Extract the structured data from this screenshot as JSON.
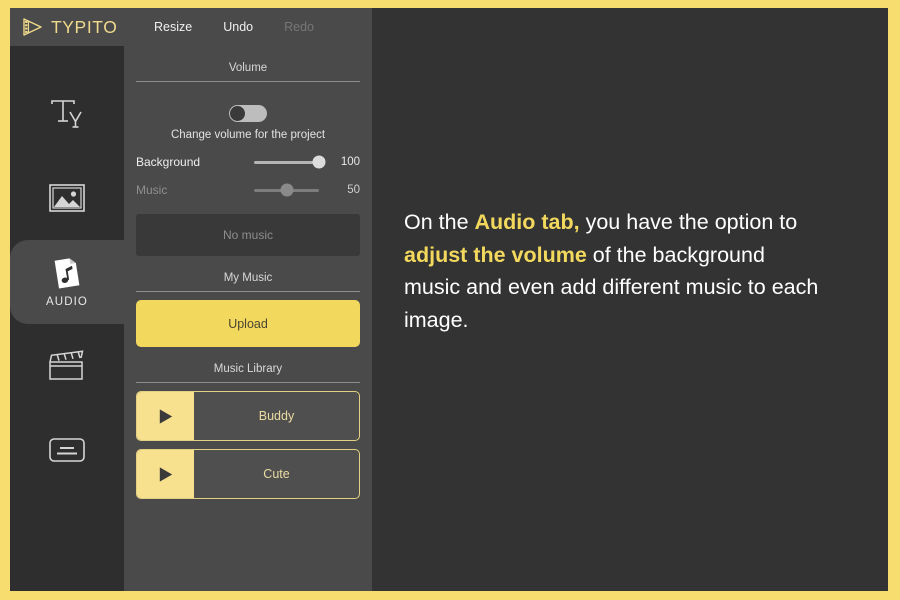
{
  "brand": {
    "name": "TYPITO",
    "logo_icon": "film-play-icon",
    "logo_color": "#EFDA8C"
  },
  "theme": {
    "frame_border": "#F7DC6F",
    "rail_bg": "#2e2e2e",
    "panel_bg": "#4a4a4a",
    "preview_bg": "#333333",
    "accent": "#F2D95E",
    "accent_soft": "#F7E08E"
  },
  "toolbar": {
    "items": [
      {
        "label": "Resize",
        "icon": "resize-icon",
        "disabled": false
      },
      {
        "label": "Undo",
        "icon": "undo-icon",
        "disabled": false
      },
      {
        "label": "Redo",
        "icon": "redo-icon",
        "disabled": true
      }
    ]
  },
  "rail": {
    "items": [
      {
        "id": "text",
        "label": "",
        "icon": "text-ty-icon",
        "active": false
      },
      {
        "id": "image",
        "label": "",
        "icon": "image-icon",
        "active": false
      },
      {
        "id": "audio",
        "label": "AUDIO",
        "icon": "audio-note-icon",
        "active": true
      },
      {
        "id": "video",
        "label": "",
        "icon": "clapperboard-icon",
        "active": false
      },
      {
        "id": "subtitle",
        "label": "",
        "icon": "subtitle-icon",
        "active": false
      }
    ]
  },
  "panel": {
    "volume_section": {
      "title": "Volume",
      "toggle": {
        "caption": "Change volume for the project",
        "state": "off"
      },
      "sliders": [
        {
          "label": "Background",
          "value": "100",
          "percent": 100,
          "disabled": false
        },
        {
          "label": "Music",
          "value": "50",
          "percent": 50,
          "disabled": true
        }
      ]
    },
    "no_music_label": "No music",
    "my_music_section": {
      "title": "My Music",
      "upload_label": "Upload"
    },
    "music_library_section": {
      "title": "Music Library",
      "tracks": [
        {
          "name": "Buddy",
          "play_icon": "play-icon"
        },
        {
          "name": "Cute",
          "play_icon": "play-icon"
        }
      ]
    }
  },
  "preview": {
    "overlay": {
      "part1": "On the ",
      "hl1": "Audio tab,",
      "part2": " you have the option to ",
      "hl2": "adjust the volume",
      "part3": " of the background music and even add different music to each image."
    }
  }
}
